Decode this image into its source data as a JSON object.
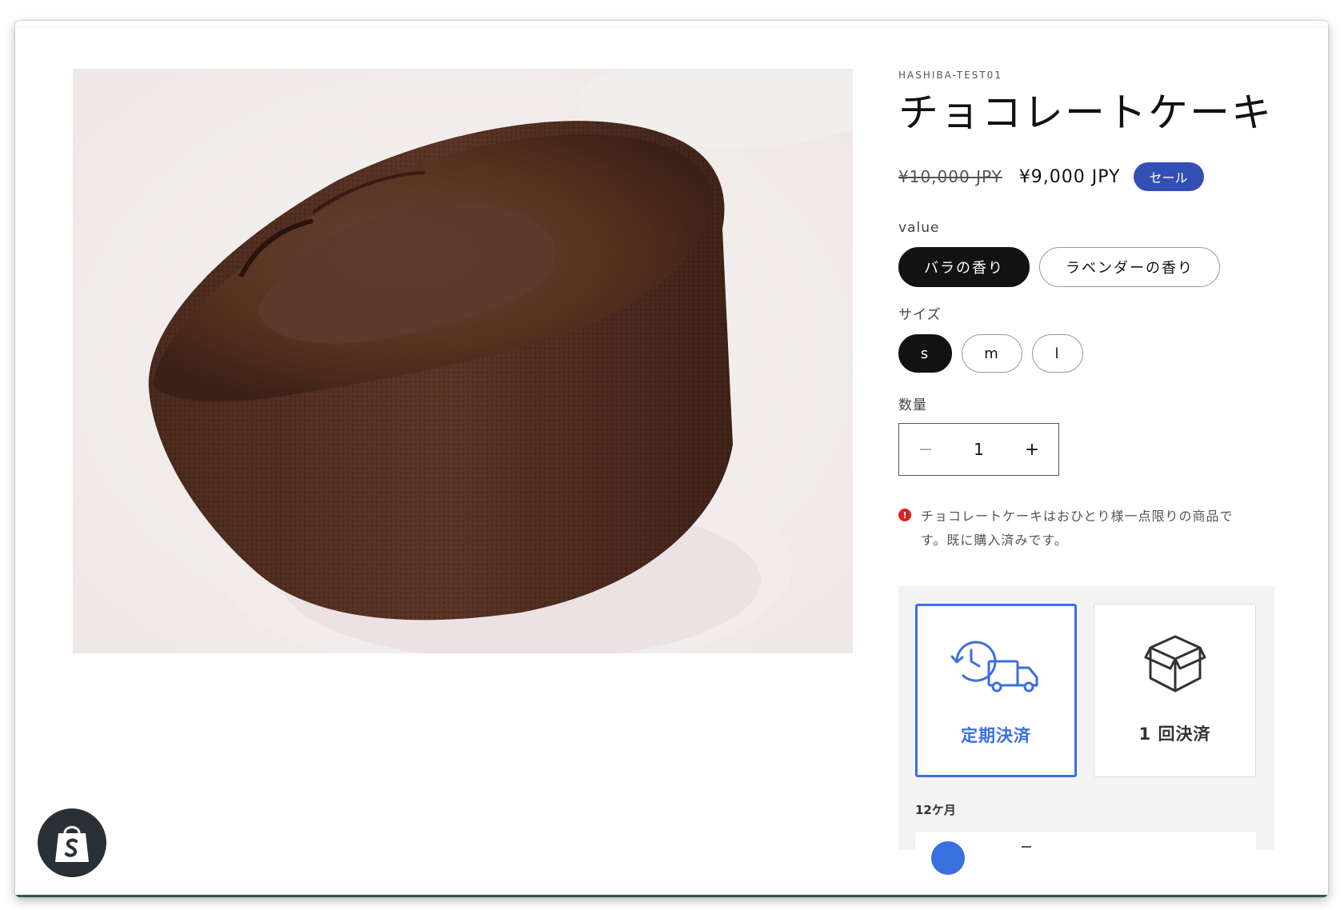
{
  "product": {
    "vendor": "HASHIBA-TEST01",
    "title": "チョコレートケーキ",
    "price_original": "¥10,000 JPY",
    "price_sale": "¥9,000 JPY",
    "sale_badge": "セール"
  },
  "options": {
    "value": {
      "label": "value",
      "choices": [
        "バラの香り",
        "ラベンダーの香り"
      ],
      "selected": "バラの香り"
    },
    "size": {
      "label": "サイズ",
      "choices": [
        "s",
        "m",
        "l"
      ],
      "selected": "s"
    }
  },
  "quantity": {
    "label": "数量",
    "value": "1",
    "minus": "−",
    "plus": "+"
  },
  "error": {
    "icon": "!",
    "message": "チョコレートケーキはおひとり様一点限りの商品です。既に購入済みです。"
  },
  "subscription": {
    "plans": [
      {
        "label": "定期決済",
        "icon": "recurring-delivery-truck-icon",
        "selected": true
      },
      {
        "label": "1 回決済",
        "icon": "box-icon",
        "selected": false
      }
    ],
    "frequency_label": "12ケ月"
  },
  "colors": {
    "sale_badge": "#334fb4",
    "accent": "#3a6fe0",
    "selected_pill": "#121212",
    "error": "#dd2222"
  }
}
